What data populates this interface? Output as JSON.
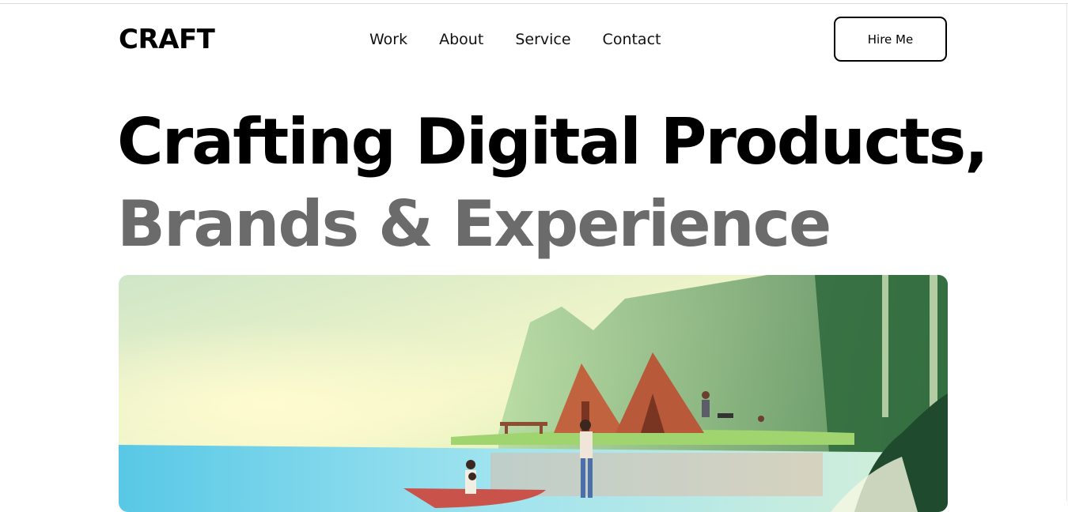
{
  "header": {
    "logo": "CRAFT",
    "nav": [
      "Work",
      "About",
      "Service",
      "Contact"
    ],
    "cta_label": "Hire Me"
  },
  "hero": {
    "headline_line1": "Crafting Digital Products,",
    "headline_line2": "Brands & Experience",
    "image_alt": "lakeside-camping-illustration"
  },
  "colors": {
    "text_primary": "#000000",
    "text_secondary": "#6b6b6b",
    "background": "#ffffff"
  }
}
